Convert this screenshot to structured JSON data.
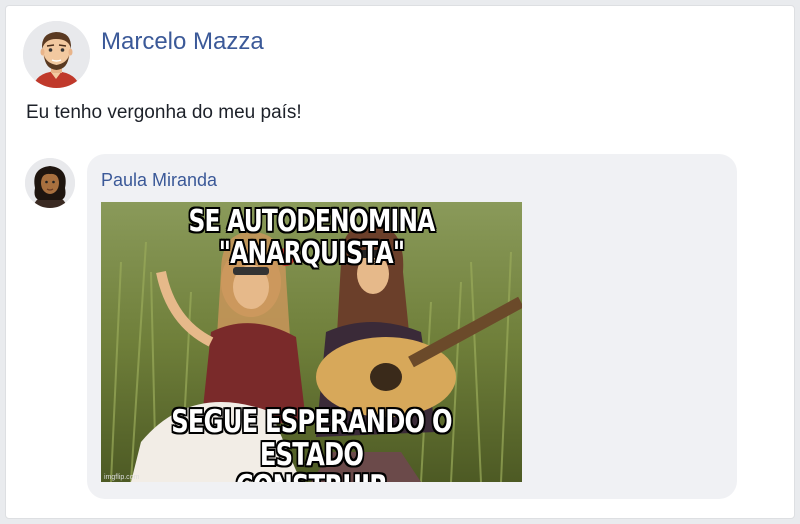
{
  "post": {
    "author": "Marcelo Mazza",
    "text": "Eu tenho vergonha do meu país!"
  },
  "comment": {
    "author": "Paula Miranda",
    "meme": {
      "top_text": "SE AUTODENOMINA \"ANARQUISTA\"",
      "bottom_line1": "SEGUE ESPERANDO O ESTADO",
      "bottom_line2": "CONSTRUIR UNIVERSIDADES",
      "watermark": "imgflip.com"
    }
  }
}
